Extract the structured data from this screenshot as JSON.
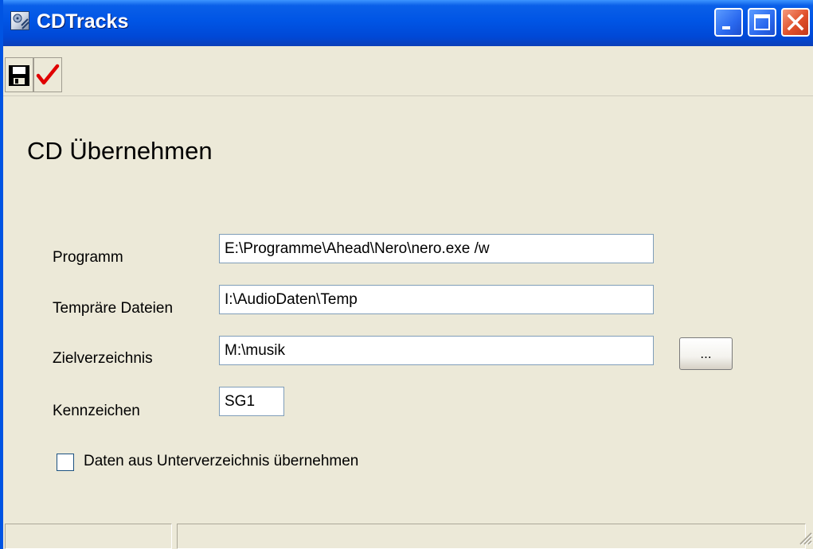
{
  "window": {
    "title": "CDTracks",
    "icon": "app-icon",
    "controls": [
      "minimize-icon",
      "maximize-icon",
      "close-icon"
    ]
  },
  "toolbar": {
    "save_icon": "floppy-disk-icon",
    "confirm_icon": "red-checkmark-icon"
  },
  "form": {
    "heading": "CD Übernehmen",
    "fields": [
      {
        "label": "Programm",
        "value": "E:\\Programme\\Ahead\\Nero\\nero.exe /w"
      },
      {
        "label": "Tempräre Dateien",
        "value": "I:\\AudioDaten\\Temp"
      },
      {
        "label": "Zielverzeichnis",
        "value": "M:\\musik"
      },
      {
        "label": "Kennzeichen",
        "value": "SG1"
      }
    ],
    "browse_label": "...",
    "checkbox": {
      "label": "Daten aus Unterverzeichnis übernehmen",
      "checked": false
    }
  },
  "statusbar": {
    "panes": [
      "",
      ""
    ]
  },
  "colors": {
    "titlebar": "#0055e5",
    "window_bg": "#ece9d8",
    "checkmark": "#e00000"
  }
}
